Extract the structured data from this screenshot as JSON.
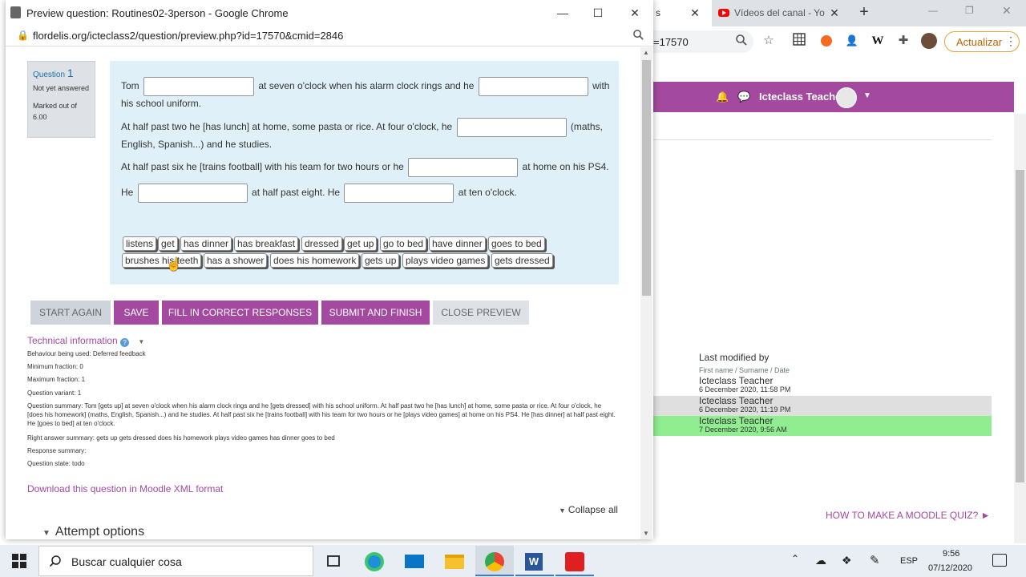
{
  "background_browser": {
    "partial_tab_title": "s",
    "youtube_tab_title": "Vídeos del canal - Yo",
    "url_fragment": "=17570",
    "update_button": "Actualizar",
    "teacher_name": "Icteclass Teacher",
    "last_modified": {
      "title": "Last modified by",
      "subtitle": "First name / Surname / Date",
      "rows": [
        {
          "name": "Icteclass Teacher",
          "date": "6 December 2020, 11:58 PM"
        },
        {
          "name": "Icteclass Teacher",
          "date": "6 December 2020, 11:19 PM"
        },
        {
          "name": "Icteclass Teacher",
          "date": "7 December 2020, 9:56 AM"
        }
      ]
    },
    "howto_link": "HOW TO MAKE A MOODLE QUIZ? ►"
  },
  "popup": {
    "title": "Preview question: Routines02-3person - Google Chrome",
    "url": "flordelis.org/icteclass2/question/preview.php?id=17570&cmid=2846",
    "question_info": {
      "label": "Question",
      "number": "1",
      "state": "Not yet answered",
      "mark": "Marked out of 6.00"
    },
    "question_text": {
      "l1a": "Tom",
      "l1b": "at seven o'clock when his alarm clock rings and he",
      "l1c": "with",
      "l1d": "his school uniform.",
      "l2a": "At half past two he [has lunch] at home, some pasta or rice. At four o'clock, he",
      "l2b": "(maths,",
      "l2c": "English, Spanish...) and he studies.",
      "l3a": "At half past six he [trains football] with his team for two hours or he",
      "l3b": "at home on his PS4.",
      "l4a": "He",
      "l4b": "at half past eight. He",
      "l4c": "at ten o'clock."
    },
    "drag_items": [
      "listens",
      "get",
      "has dinner",
      "has breakfast",
      "dressed",
      "get up",
      "go to bed",
      "have dinner",
      "goes to bed",
      "brushes his teeth",
      "has a shower",
      "does his homework",
      "gets up",
      "plays video games",
      "gets dressed"
    ],
    "buttons": {
      "start_again": "START AGAIN",
      "save": "SAVE",
      "fill": "FILL IN CORRECT RESPONSES",
      "submit": "SUBMIT AND FINISH",
      "close": "CLOSE PREVIEW"
    },
    "technical": {
      "title": "Technical information",
      "behaviour": "Behaviour being used: Deferred feedback",
      "min_fraction": "Minimum fraction: 0",
      "max_fraction": "Maximum fraction: 1",
      "variant": "Question variant: 1",
      "summary": "Question summary: Tom [gets up] at seven o'clock when his alarm clock rings and he [gets dressed] with his school uniform.  At half past two he [has lunch] at home, some pasta or rice. At four o'clock, he [does his homework] (maths, English, Spanish...) and he studies.  At half past six he [trains football] with his team for two hours or he [plays video games] at home on his PS4. He [has dinner] at half past eight. He [goes to bed] at ten o'clock.",
      "right_answer": "Right answer summary: gets up gets dressed does his homework plays video games has dinner goes to bed",
      "response": "Response summary:",
      "state": "Question state: todo"
    },
    "download_link": "Download this question in Moodle XML format",
    "collapse_all": "Collapse all",
    "attempt_options": "Attempt options"
  },
  "taskbar": {
    "search_placeholder": "Buscar cualquier cosa",
    "language": "ESP",
    "time": "9:56",
    "date": "07/12/2020"
  },
  "colors": {
    "moodle_purple": "#a34aa0",
    "question_bg": "#dff0f8",
    "highlight_row": "#90ee90"
  }
}
